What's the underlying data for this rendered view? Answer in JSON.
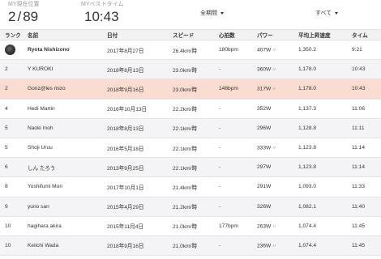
{
  "summary": {
    "my_position_label": "MY現在位置",
    "my_position_rank": "2",
    "my_position_total": "89",
    "best_time_label": "MYベストタイム",
    "best_time_value": "10:43",
    "period_filter": "全期間",
    "scope_filter": "すべて"
  },
  "table": {
    "headers": {
      "rank": "ランク",
      "name": "名前",
      "date": "日付",
      "speed": "スピード",
      "heart_rate": "心拍数",
      "power": "パワー",
      "vam": "平均上昇速度",
      "time": "タイム"
    },
    "rows": [
      {
        "rank": "",
        "name": "Ryota Nishizono",
        "date": "2017年8月27日",
        "speed": "26.4km/時",
        "hr": "180bpm",
        "power": "407W",
        "vam": "1,350.2",
        "time": "9:21"
      },
      {
        "rank": "2",
        "name": "Y KUROKI",
        "date": "2018年8月13日",
        "speed": "23.0km/時",
        "hr": "-",
        "power": "360W",
        "vam": "1,178.0",
        "time": "10:43"
      },
      {
        "rank": "2",
        "name": "Gonz@les mizo",
        "date": "2018年9月16日",
        "speed": "23.0km/時",
        "hr": "148bpm",
        "power": "317W",
        "vam": "1,178.0",
        "time": "10:43"
      },
      {
        "rank": "4",
        "name": "Hedi Martin",
        "date": "2016年10月13日",
        "speed": "22.2km/時",
        "hr": "-",
        "power": "352W",
        "vam": "1,137.3",
        "time": "11:06"
      },
      {
        "rank": "5",
        "name": "Naoki Inoh",
        "date": "2018年8月13日",
        "speed": "22.1km/時",
        "hr": "-",
        "power": "296W",
        "vam": "1,128.8",
        "time": "11:11"
      },
      {
        "rank": "5",
        "name": "Shoji Uruu",
        "date": "2016年5月18日",
        "speed": "22.1km/時",
        "hr": "-",
        "power": "333W",
        "vam": "1,123.8",
        "time": "11:14"
      },
      {
        "rank": "6",
        "name": "しん たろう",
        "date": "2013年9月25日",
        "speed": "22.1km/時",
        "hr": "-",
        "power": "297W",
        "vam": "1,123.8",
        "time": "11:14"
      },
      {
        "rank": "8",
        "name": "Yoshifumi Mori",
        "date": "2017年10月1日",
        "speed": "21.4km/時",
        "hr": "-",
        "power": "291W",
        "vam": "1,093.0",
        "time": "11:33"
      },
      {
        "rank": "9",
        "name": "yuno san",
        "date": "2015年4月29日",
        "speed": "21.2km/時",
        "hr": "-",
        "power": "326W",
        "vam": "1,082.1",
        "time": "11:40"
      },
      {
        "rank": "10",
        "name": "hagihara akira",
        "date": "2015年11月4日",
        "speed": "21.0km/時",
        "hr": "177bpm",
        "power": "263W",
        "vam": "1,074.4",
        "time": "11:45"
      },
      {
        "rank": "10",
        "name": "Keiichi Wada",
        "date": "2018年9月16日",
        "speed": "21.0km/時",
        "hr": "-",
        "power": "236W",
        "vam": "1,074.4",
        "time": "11:45"
      }
    ]
  },
  "icons": {
    "power_estimated": "lightning-icon"
  },
  "colors": {
    "link": "#2f7fbf",
    "highlight_row": "#fbdcd0",
    "header_bg": "#f2f2f2"
  }
}
